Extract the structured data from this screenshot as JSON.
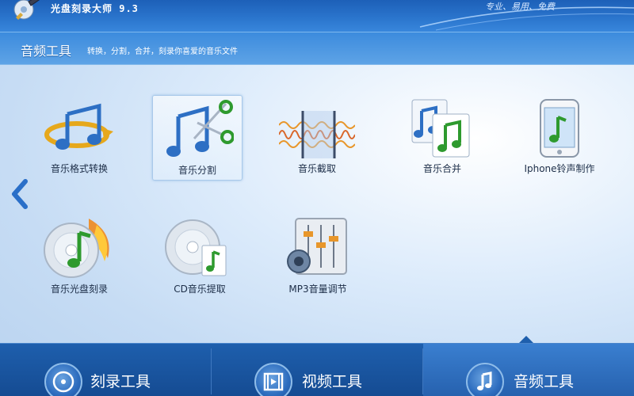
{
  "app": {
    "title": "光盘刻录大师 9.3",
    "slogan": "专业、易用、免费"
  },
  "header": {
    "section_title": "音频工具",
    "section_desc": "转换，分割，合并，刻录你喜爱的音乐文件"
  },
  "nav": {
    "prev_icon": "chevron-left-icon"
  },
  "tools": [
    {
      "label": "音乐格式转换",
      "icon": "music-convert-icon"
    },
    {
      "label": "音乐分割",
      "icon": "music-split-icon",
      "selected": true
    },
    {
      "label": "音乐截取",
      "icon": "waveform-trim-icon"
    },
    {
      "label": "音乐合并",
      "icon": "music-merge-icon"
    },
    {
      "label": "Iphone铃声制作",
      "icon": "iphone-ringtone-icon"
    },
    {
      "label": "音乐光盘刻录",
      "icon": "music-disc-burn-icon"
    },
    {
      "label": "CD音乐提取",
      "icon": "cd-extract-icon"
    },
    {
      "label": "MP3音量调节",
      "icon": "mp3-volume-icon"
    }
  ],
  "bottom_tabs": [
    {
      "label": "刻录工具",
      "icon": "disc-icon"
    },
    {
      "label": "视频工具",
      "icon": "film-icon"
    },
    {
      "label": "音频工具",
      "icon": "music-note-icon",
      "active": true
    }
  ],
  "colors": {
    "titlebar": "#2a74cc",
    "bottombar": "#1e5fad",
    "accent": "#2e9a2e"
  }
}
